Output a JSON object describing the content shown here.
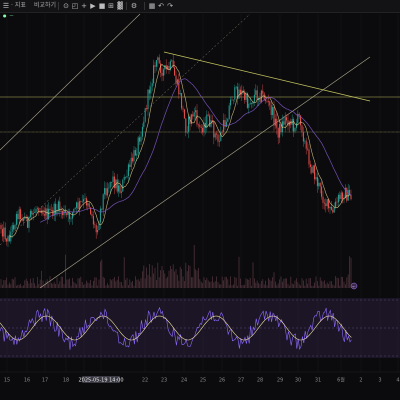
{
  "toolbar": {
    "items": [
      {
        "label": "· 지표",
        "name": "indicators-menu"
      },
      {
        "label": "비교하기",
        "name": "compare-menu"
      }
    ],
    "icons": [
      "pattern-icon",
      "alert-icon",
      "plus-icon",
      "bar-replay-icon",
      "undo-icon",
      "redo-icon"
    ]
  },
  "x_axis": {
    "labels": [
      "15",
      "16",
      "17",
      "18",
      "19",
      "2025-05-19  14:00",
      "22",
      "23",
      "24",
      "25",
      "26",
      "27",
      "28",
      "29",
      "30",
      "31",
      "6월",
      "2",
      "3",
      "4"
    ]
  },
  "indicator_badge": "←",
  "colors": {
    "background": "#0b0b0d",
    "candle_up": "#26a69a",
    "candle_down": "#ef5350",
    "channel": "#d8d0b0",
    "horizontal": "#d9d86a",
    "ma_gold": "#e9d28a",
    "ma_purple": "#7e57c2",
    "rsi_band": "#2a1f3d",
    "rsi_line": "#8f6bff",
    "rsi_signal": "#f0e0a0"
  }
}
